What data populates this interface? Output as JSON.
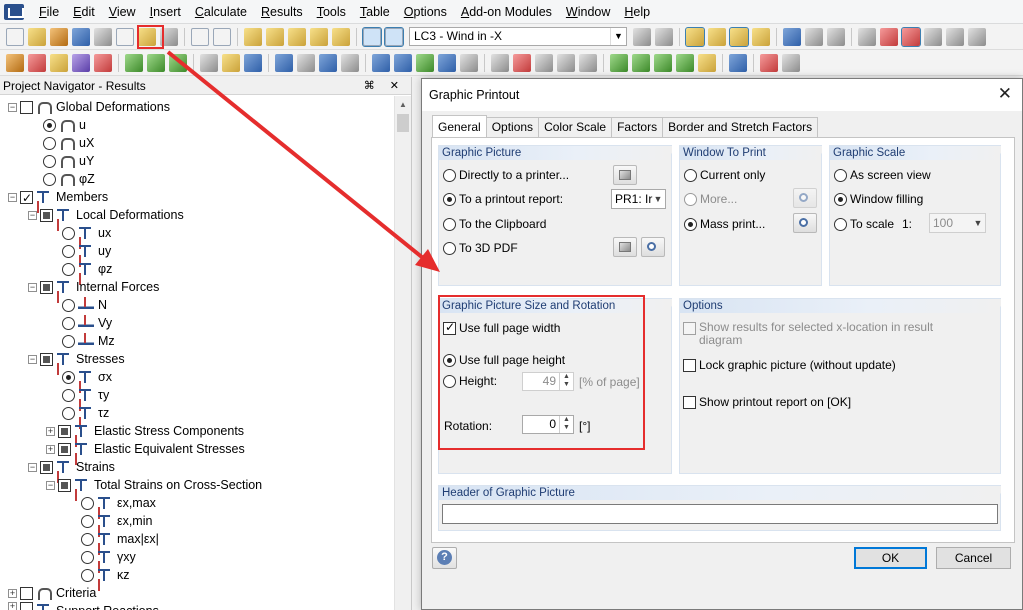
{
  "menu": [
    {
      "label": "File",
      "ul": "F",
      "rest": "ile"
    },
    {
      "label": "Edit",
      "ul": "E",
      "rest": "dit"
    },
    {
      "label": "View",
      "ul": "V",
      "rest": "iew"
    },
    {
      "label": "Insert",
      "ul": "I",
      "rest": "nsert"
    },
    {
      "label": "Calculate",
      "ul": "C",
      "rest": "alculate"
    },
    {
      "label": "Results",
      "ul": "R",
      "rest": "esults"
    },
    {
      "label": "Tools",
      "ul": "T",
      "rest": "ools"
    },
    {
      "label": "Table",
      "ul": "T",
      "rest": "able"
    },
    {
      "label": "Options",
      "ul": "O",
      "rest": "ptions"
    },
    {
      "label": "Add-on Modules",
      "ul": "A",
      "rest": "dd-on Modules"
    },
    {
      "label": "Window",
      "ul": "W",
      "rest": "indow"
    },
    {
      "label": "Help",
      "ul": "H",
      "rest": "elp"
    }
  ],
  "toolbar": {
    "load_case": "LC3 - Wind in -X"
  },
  "navigator": {
    "title": "Project Navigator - Results",
    "pin": "⌘ ✕",
    "items": {
      "global_deformations": "Global Deformations",
      "u": "u",
      "ux": "uX",
      "uy": "uY",
      "phiz": "φZ",
      "members": "Members",
      "local_deformations": "Local Deformations",
      "lux": "ux",
      "luy": "uy",
      "lphiz": "φz",
      "internal_forces": "Internal Forces",
      "n": "N",
      "vy": "Vy",
      "mz": "Mz",
      "stresses": "Stresses",
      "sigx": "σx",
      "tauy": "τy",
      "tauz": "τz",
      "elastic_stress_components": "Elastic Stress Components",
      "elastic_equivalent_stresses": "Elastic Equivalent Stresses",
      "strains": "Strains",
      "total_strains": "Total Strains on Cross-Section",
      "exmax": "εx,max",
      "exmin": "εx,min",
      "maxex": "max|εx|",
      "gxy": "γxy",
      "kz": "κz",
      "criteria": "Criteria",
      "support_reactions": "Support Reactions"
    }
  },
  "dialog": {
    "title": "Graphic Printout",
    "close": "✕",
    "tabs": [
      "General",
      "Options",
      "Color Scale",
      "Factors",
      "Border and Stretch Factors"
    ],
    "graphic_picture": {
      "header": "Graphic Picture",
      "directly_printer": "Directly to a printer...",
      "printout_report": "To a printout report:",
      "report_value": "PR1: Ir",
      "clipboard": "To the Clipboard",
      "pdf": "To 3D PDF"
    },
    "window_to_print": {
      "header": "Window To Print",
      "current_only": "Current only",
      "more": "More...",
      "mass_print": "Mass print..."
    },
    "graphic_scale": {
      "header": "Graphic Scale",
      "as_screen": "As screen view",
      "window_filling": "Window filling",
      "to_scale": "To scale",
      "scale_prefix": "1:",
      "scale_value": "100"
    },
    "size_rotation": {
      "header": "Graphic Picture Size and Rotation",
      "full_width": "Use full page width",
      "full_height": "Use full page height",
      "height": "Height:",
      "height_value": "49",
      "height_unit": "[% of page]",
      "rotation": "Rotation:",
      "rotation_value": "0",
      "rotation_unit": "[°]"
    },
    "options": {
      "header": "Options",
      "show_results_1": "Show results for selected x-location in result",
      "show_results_2": "diagram",
      "lock_picture": "Lock graphic picture (without update)",
      "show_report": "Show printout report on [OK]"
    },
    "header_picture": {
      "header": "Header of Graphic Picture",
      "value": ""
    },
    "help": "?",
    "ok": "OK",
    "cancel": "Cancel"
  }
}
